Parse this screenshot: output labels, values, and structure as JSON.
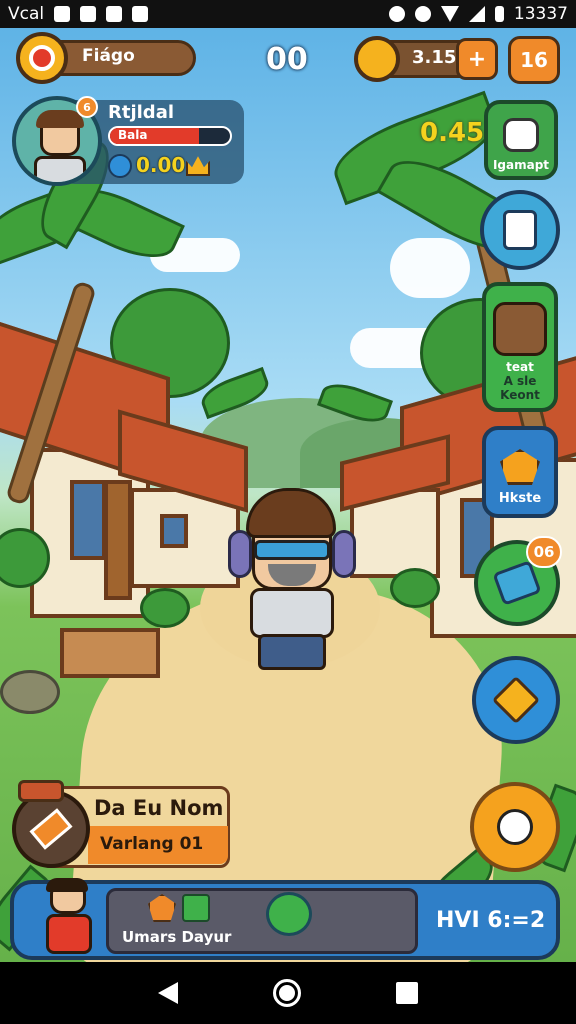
{
  "status_bar": {
    "left_text": "Vcal",
    "time": "13337"
  },
  "hud": {
    "flag_label": "Fiágo",
    "center_counter": "00",
    "gold_amount": "3.15",
    "plus_symbol": "+",
    "gems_amount": "16"
  },
  "profile": {
    "name": "Rtjldal",
    "level_badge": "6",
    "bar_label": "Bala",
    "resource_value": "0.00"
  },
  "side": {
    "score": "0.45",
    "card1_label": "Igamapt",
    "card3_top": "teat",
    "card3_bottom": "A sle Keont",
    "card4_label": "Hkste",
    "badge_count": "06"
  },
  "quest": {
    "title": "Da Eu Nom",
    "subtitle": "Varlang 01"
  },
  "bottom": {
    "label": "Umars Dayur",
    "right_text": "HVI 6:=2"
  },
  "colors": {
    "gold": "#f5b21e",
    "orange": "#f08a2a",
    "health_red": "#e23b2a",
    "blue": "#2f8fd8",
    "green": "#3fb14a"
  },
  "icons": [
    "target-icon",
    "coin-icon",
    "plus-icon",
    "goat-icon",
    "tools-icon",
    "fox-icon",
    "ribbon-icon",
    "sword-icon",
    "panda-icon",
    "back-icon",
    "home-icon",
    "recents-icon"
  ]
}
